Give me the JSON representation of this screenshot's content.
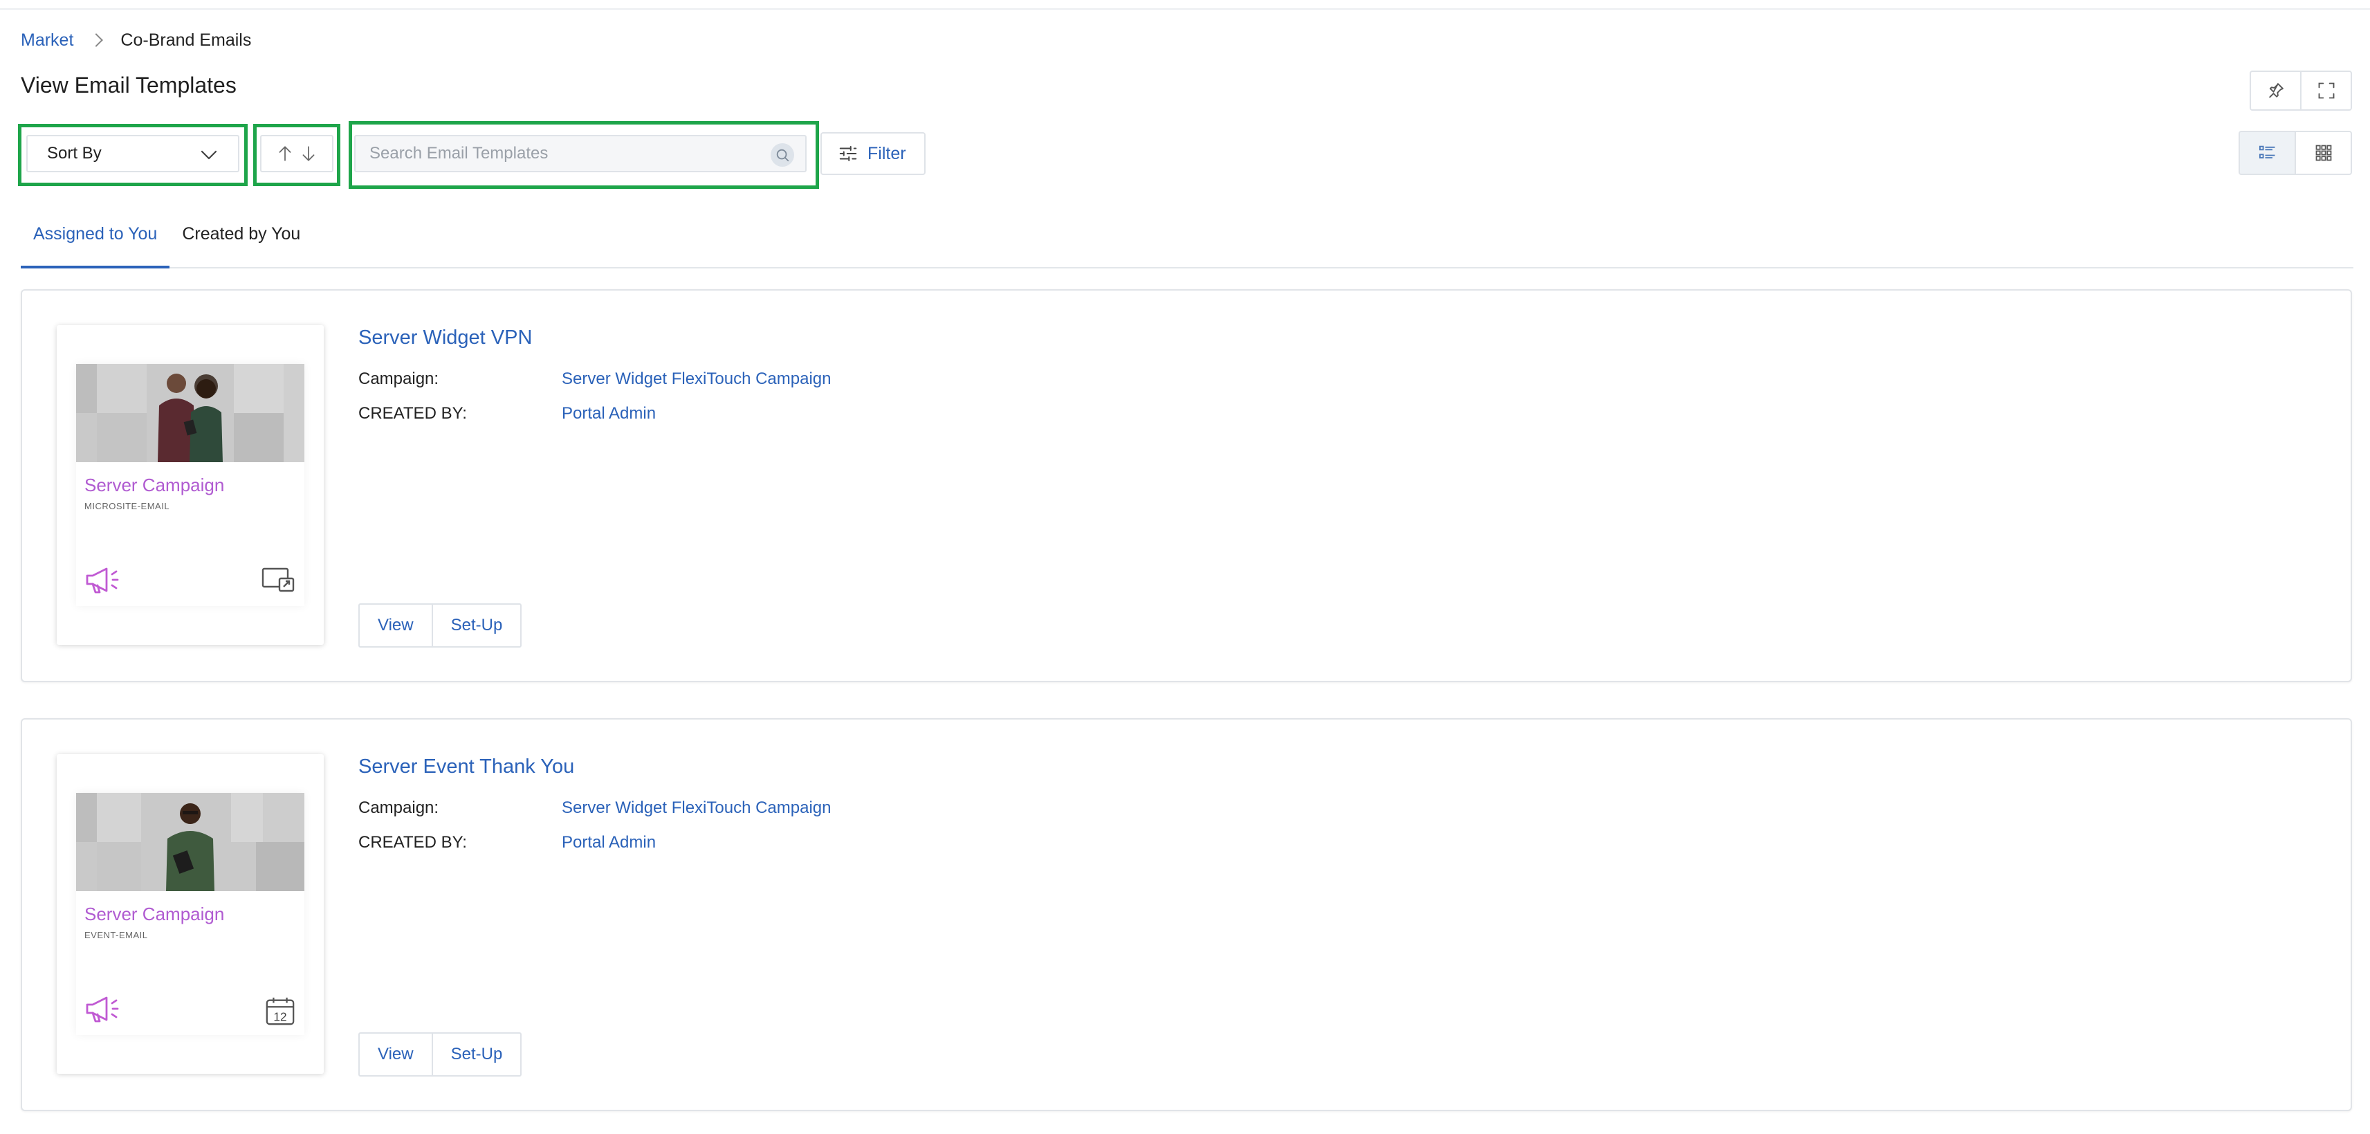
{
  "breadcrumb": {
    "root": "Market",
    "current": "Co-Brand Emails"
  },
  "page": {
    "title": "View Email Templates"
  },
  "toolbar": {
    "sort_label": "Sort By",
    "search_placeholder": "Search Email Templates",
    "filter_label": "Filter"
  },
  "tabs": [
    {
      "label": "Assigned to You",
      "active": true
    },
    {
      "label": "Created by You",
      "active": false
    }
  ],
  "cards": [
    {
      "title": "Server Widget VPN",
      "campaign_label": "Campaign:",
      "campaign_value": "Server Widget FlexiTouch Campaign",
      "created_label": "CREATED BY:",
      "created_value": "Portal Admin",
      "thumb_name": "Server Campaign",
      "thumb_sub": "MICROSITE-EMAIL",
      "type_icon": "microsite-icon",
      "view_label": "View",
      "setup_label": "Set-Up"
    },
    {
      "title": "Server Event Thank You",
      "campaign_label": "Campaign:",
      "campaign_value": "Server Widget FlexiTouch Campaign",
      "created_label": "CREATED BY:",
      "created_value": "Portal Admin",
      "thumb_name": "Server Campaign",
      "thumb_sub": "EVENT-EMAIL",
      "type_icon": "calendar-icon",
      "calendar_day": "12",
      "view_label": "View",
      "setup_label": "Set-Up"
    }
  ],
  "colors": {
    "link": "#2b62b9",
    "highlight": "#1ea54a",
    "thumb_accent": "#b05bd1"
  }
}
